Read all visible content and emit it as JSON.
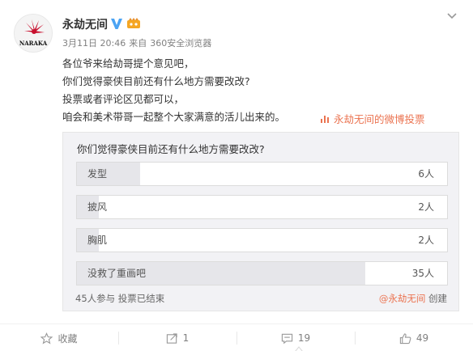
{
  "post": {
    "author": "永劫无间",
    "avatar_text": "NARAKA",
    "date": "3月11日 20:46",
    "source_prefix": "来自",
    "source": "360安全浏览器",
    "lines": [
      "各位爷来给劫哥提个意见吧，",
      "你们觉得豪侠目前还有什么地方需要改改?",
      "投票或者评论区见都可以，",
      "咱会和美术带哥一起整个大家满意的活儿出来的。"
    ],
    "vote_link": "永劫无间的微博投票"
  },
  "poll": {
    "title": "你们觉得豪侠目前还有什么地方需要改改?",
    "options": [
      {
        "label": "发型",
        "count": "6人",
        "share": 0.17
      },
      {
        "label": "披风",
        "count": "2人",
        "share": 0.06
      },
      {
        "label": "胸肌",
        "count": "2人",
        "share": 0.06
      },
      {
        "label": "没救了重画吧",
        "count": "35人",
        "share": 0.78
      }
    ],
    "participants": "45人参与",
    "status": "投票已结束",
    "creator": "@永劫无间",
    "created_label": "创建"
  },
  "actions": {
    "favorite": "收藏",
    "repost": "1",
    "comment": "19",
    "like": "49"
  },
  "colors": {
    "accent": "#eb7350",
    "verified": "#4ba3f3",
    "vip": "#f5a623",
    "text": "#333333",
    "muted": "#808080"
  },
  "icons": [
    "naraka-logo",
    "verified-icon",
    "vip-crown-icon",
    "chevron-down-icon",
    "vote-icon",
    "star-icon",
    "repost-icon",
    "comment-icon",
    "thumbs-up-icon"
  ]
}
